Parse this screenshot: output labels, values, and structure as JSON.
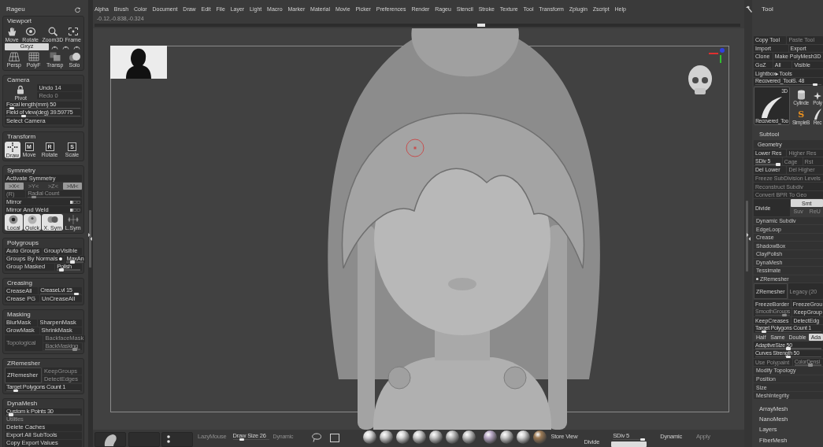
{
  "left_panel": {
    "title": "Rageu",
    "sections": [
      {
        "title": "Viewport",
        "rows": [
          [
            {
              "kind": "tool",
              "text": "Move",
              "selected": false
            },
            {
              "kind": "tool",
              "text": "Rotate",
              "selected": false
            },
            {
              "kind": "tool",
              "text": "Zoom3D",
              "selected": false
            },
            {
              "kind": "tool",
              "text": "Frame",
              "selected": false
            }
          ],
          [
            {
              "kind": "toggle",
              "text": "Gxyz",
              "selected": true,
              "disabled": false
            },
            {
              "kind": "mini",
              "selected": false
            },
            {
              "kind": "mini",
              "selected": false
            },
            {
              "kind": "mini",
              "selected": false
            }
          ],
          [
            {
              "kind": "tool",
              "text": "Persp",
              "selected": false
            },
            {
              "kind": "tool",
              "text": "PolyF",
              "selected": false
            },
            {
              "kind": "tool",
              "text": "Transp",
              "selected": false
            },
            {
              "kind": "tool",
              "text": "Solo",
              "selected": false
            }
          ]
        ]
      },
      {
        "title": "Camera",
        "rows": [
          [
            {
              "kind": "tool",
              "text": "Pivot",
              "selected": false
            },
            {
              "kind": "stack",
              "rows": [
                [
                  {
                    "kind": "button",
                    "text": "Undo 14",
                    "disabled": false
                  }
                ],
                [
                  {
                    "kind": "button",
                    "text": "Redo 0",
                    "disabled": true
                  }
                ]
              ]
            }
          ],
          [
            {
              "kind": "slider",
              "text": "Focal length(mm) 50",
              "level": 0.05,
              "disabled": false
            }
          ],
          [
            {
              "kind": "slider",
              "text": "Field of view(deg) 39.59775",
              "level": 0.22,
              "disabled": false
            }
          ],
          [
            {
              "kind": "button",
              "text": "Select Camera",
              "disabled": false
            }
          ]
        ]
      },
      {
        "title": "Transform",
        "rows": [
          [
            {
              "kind": "tool",
              "text": "Draw",
              "selected": true
            },
            {
              "kind": "tool",
              "text": "Move",
              "letter": "M",
              "selected": false
            },
            {
              "kind": "tool",
              "text": "Rotate",
              "letter": "R",
              "selected": false
            },
            {
              "kind": "tool",
              "text": "Scale",
              "letter": "S",
              "selected": false
            }
          ]
        ]
      },
      {
        "title": "Symmetry",
        "rows": [
          [
            {
              "kind": "button",
              "text": "Activate Symmetry",
              "disabled": false
            }
          ],
          [
            {
              "kind": "toggle",
              "text": ">X<",
              "selected": true,
              "disabled": true
            },
            {
              "kind": "toggle",
              "text": ">Y<",
              "selected": false,
              "disabled": true
            },
            {
              "kind": "toggle",
              "text": ">Z<",
              "selected": false,
              "disabled": true
            },
            {
              "kind": "toggle",
              "text": ">M<",
              "selected": true,
              "disabled": true
            }
          ],
          [
            {
              "kind": "button",
              "text": "(R)",
              "disabled": true
            },
            {
              "kind": "slider",
              "text": "Radial Count",
              "level": 0.08,
              "disabled": true
            }
          ],
          [
            {
              "kind": "option",
              "text": "Mirror",
              "disabled": false
            }
          ],
          [
            {
              "kind": "option",
              "text": "Mirror And Weld",
              "disabled": false
            }
          ],
          [
            {
              "kind": "tool",
              "text": "Local",
              "selected": true
            },
            {
              "kind": "tool",
              "text": "Quick",
              "selected": true
            },
            {
              "kind": "tool",
              "text": "X. Sym",
              "selected": true
            },
            {
              "kind": "tool",
              "text": "L.Sym",
              "selected": false
            }
          ]
        ]
      },
      {
        "title": "Polygroups",
        "rows": [
          [
            {
              "kind": "button",
              "text": "Auto Groups",
              "disabled": false
            },
            {
              "kind": "button",
              "text": "GroupVisible",
              "disabled": false
            }
          ],
          [
            {
              "kind": "switch",
              "text": "Groups By Normals",
              "on": true,
              "disabled": false
            },
            {
              "kind": "slider",
              "text": "MaxAn",
              "level": 0.3,
              "disabled": false
            }
          ],
          [
            {
              "kind": "button",
              "text": "Group Masked",
              "disabled": false
            },
            {
              "kind": "slider",
              "text": "Polish",
              "level": 0.1,
              "disabled": false
            }
          ]
        ]
      },
      {
        "title": "Creasing",
        "rows": [
          [
            {
              "kind": "button",
              "text": "CreaseAll",
              "disabled": false
            },
            {
              "kind": "slider",
              "text": "CreaseLvl 15",
              "level": 0.95,
              "disabled": false
            }
          ],
          [
            {
              "kind": "button",
              "text": "Crease PG",
              "disabled": false
            },
            {
              "kind": "button",
              "text": "UnCreaseAll",
              "disabled": false
            }
          ]
        ]
      },
      {
        "title": "Masking",
        "rows": [
          [
            {
              "kind": "button",
              "text": "BlurMask",
              "disabled": false
            },
            {
              "kind": "button",
              "text": "SharpenMask",
              "disabled": false
            }
          ],
          [
            {
              "kind": "button",
              "text": "GrowMask",
              "disabled": false
            },
            {
              "kind": "button",
              "text": "ShrinkMask",
              "disabled": false
            }
          ],
          [
            {
              "kind": "button",
              "text": "Topological",
              "disabled": true
            },
            {
              "kind": "stack",
              "rows": [
                [
                  {
                    "kind": "button",
                    "text": "BackfaceMask",
                    "disabled": true
                  }
                ],
                [
                  {
                    "kind": "slider",
                    "text": "BackMasking",
                    "level": 0.9,
                    "disabled": true
                  }
                ]
              ]
            }
          ]
        ]
      },
      {
        "title": "ZRemesher",
        "rows": [
          [
            {
              "kind": "action",
              "text": "ZRemesher",
              "disabled": false
            },
            {
              "kind": "stack",
              "rows": [
                [
                  {
                    "kind": "button",
                    "text": "KeepGroups",
                    "disabled": true
                  }
                ],
                [
                  {
                    "kind": "button",
                    "text": "DetectEdges",
                    "disabled": true
                  }
                ]
              ]
            }
          ],
          [
            {
              "kind": "slider",
              "text": "Target Polygons Count 1",
              "level": 0.1,
              "disabled": false
            }
          ]
        ]
      },
      {
        "title": "DynaMesh",
        "rows": [
          [
            {
              "kind": "slider",
              "text": "Custom k Points 30",
              "level": 0.03,
              "disabled": false
            }
          ],
          [
            {
              "kind": "label",
              "text": "Utilities"
            }
          ],
          [
            {
              "kind": "button",
              "text": "Delete Caches",
              "disabled": false
            }
          ],
          [
            {
              "kind": "button",
              "text": "Export All SubTools",
              "disabled": false
            }
          ],
          [
            {
              "kind": "button",
              "text": "Copy Export Values",
              "disabled": false
            }
          ]
        ]
      }
    ]
  },
  "menu": [
    "Alpha",
    "Brush",
    "Color",
    "Document",
    "Draw",
    "Edit",
    "File",
    "Layer",
    "Light",
    "Macro",
    "Marker",
    "Material",
    "Movie",
    "Picker",
    "Preferences",
    "Render",
    "Rageu",
    "Stencil",
    "Stroke",
    "Texture",
    "Tool",
    "Transform",
    "Zplugin",
    "Zscript",
    "Help"
  ],
  "viewport": {
    "coordinates": "-0.12,-0.838,-0.324",
    "timeline": {
      "level": 0.6
    }
  },
  "bottom_bar": {
    "lazy_mouse": {
      "text": "LazyMouse",
      "disabled": true
    },
    "draw_size": {
      "text": "Draw Size 26",
      "level": 0.2,
      "disabled": false
    },
    "dynamic_size": {
      "text": "Dynamic",
      "disabled": true
    },
    "store_view": {
      "text": "Store View",
      "disabled": false
    },
    "divide": {
      "text": "Divide",
      "disabled": false
    },
    "sdiv": {
      "text": "SDiv 5",
      "level": 1,
      "disabled": false
    },
    "dynamic_subdiv": {
      "text": "Dynamic",
      "disabled": false
    },
    "apply": {
      "text": "Apply",
      "disabled": true
    }
  },
  "right_panel": {
    "title": "Tool",
    "rows": [
      [
        {
          "kind": "button",
          "text": "Copy Tool",
          "disabled": false
        },
        {
          "kind": "button",
          "text": "Paste Tool",
          "disabled": true
        }
      ],
      [
        {
          "kind": "button",
          "text": "Import",
          "disabled": false
        },
        {
          "kind": "button",
          "text": "Export",
          "disabled": false
        }
      ],
      [
        {
          "kind": "button",
          "text": "Clone",
          "disabled": false
        },
        {
          "kind": "button",
          "text": "Make PolyMesh3D",
          "disabled": false
        }
      ],
      [
        {
          "kind": "button",
          "text": "GoZ",
          "disabled": false
        },
        {
          "kind": "button",
          "text": "All",
          "disabled": false
        },
        {
          "kind": "button",
          "text": "Visible",
          "disabled": false
        }
      ],
      [
        {
          "kind": "button",
          "text": "Lightbox▸Tools",
          "disabled": false
        }
      ],
      [
        {
          "kind": "slider",
          "text": "Recovered_ToolS. 48",
          "level": 0.93,
          "disabled": false
        }
      ],
      [
        {
          "kind": "tools",
          "items": [
            {
              "label": "Recovered_Too",
              "tag": "3D"
            },
            {
              "label": "Cylinde"
            },
            {
              "label": "Poly"
            },
            {
              "label": "SimpleB",
              "glyph": "S"
            },
            {
              "label": "Rec"
            }
          ]
        }
      ],
      [
        {
          "kind": "palette",
          "text": "Subtool"
        }
      ],
      [
        {
          "kind": "heading",
          "text": "Geometry"
        }
      ],
      [
        {
          "kind": "button",
          "text": "Lower Res",
          "disabled": false
        },
        {
          "kind": "button",
          "text": "Higher Res",
          "disabled": true
        }
      ],
      [
        {
          "kind": "slider",
          "text": "SDiv 5",
          "level": 1,
          "disabled": false
        },
        {
          "kind": "button",
          "text": "Cage",
          "disabled": true
        },
        {
          "kind": "button",
          "text": "Rst",
          "disabled": true
        }
      ],
      [
        {
          "kind": "button",
          "text": "Del Lower",
          "disabled": false
        },
        {
          "kind": "button",
          "text": "Del Higher",
          "disabled": true
        }
      ],
      [
        {
          "kind": "button",
          "text": "Freeze SubDivision Levels",
          "disabled": true
        }
      ],
      [
        {
          "kind": "button",
          "text": "Reconstruct Subdiv",
          "disabled": true
        }
      ],
      [
        {
          "kind": "button",
          "text": "Convert BPR To Geo",
          "disabled": true
        }
      ],
      [
        {
          "kind": "button",
          "text": "Divide",
          "disabled": false
        },
        {
          "kind": "stack",
          "rows": [
            [
              {
                "kind": "toggle",
                "text": "Smt",
                "selected": true,
                "disabled": false
              }
            ],
            [
              {
                "kind": "toggle",
                "text": "Suv",
                "selected": false,
                "disabled": true
              },
              {
                "kind": "toggle",
                "text": "ReU",
                "selected": false,
                "disabled": true
              }
            ]
          ]
        }
      ],
      [
        {
          "kind": "subpalette",
          "text": "Dynamic Subdiv",
          "expanded": false
        }
      ],
      [
        {
          "kind": "subpalette",
          "text": "EdgeLoop",
          "expanded": false
        }
      ],
      [
        {
          "kind": "subpalette",
          "text": "Crease",
          "expanded": false
        }
      ],
      [
        {
          "kind": "subpalette",
          "text": "ShadowBox",
          "expanded": false
        }
      ],
      [
        {
          "kind": "subpalette",
          "text": "ClayPolish",
          "expanded": false
        }
      ],
      [
        {
          "kind": "subpalette",
          "text": "DynaMesh",
          "expanded": false
        }
      ],
      [
        {
          "kind": "subpalette",
          "text": "Tessimate",
          "expanded": false
        }
      ],
      [
        {
          "kind": "subpalette",
          "text": "ZRemesher",
          "expanded": true
        }
      ],
      [
        {
          "kind": "action",
          "text": "ZRemesher",
          "disabled": false
        },
        {
          "kind": "button",
          "text": "Legacy (20",
          "disabled": true
        }
      ],
      [
        {
          "kind": "button",
          "text": "FreezeBorder",
          "disabled": false
        },
        {
          "kind": "button",
          "text": "FreezeGrou",
          "disabled": false
        }
      ],
      [
        {
          "kind": "slider",
          "text": "SmoothGroups",
          "level": 0.9,
          "disabled": true
        },
        {
          "kind": "button",
          "text": "KeepGroup",
          "disabled": false
        }
      ],
      [
        {
          "kind": "button",
          "text": "KeepCreases",
          "disabled": false
        },
        {
          "kind": "button",
          "text": "DetectEdg",
          "disabled": false
        }
      ],
      [
        {
          "kind": "slider",
          "text": "Target Polygons Count 1",
          "level": 0.1,
          "disabled": false
        }
      ],
      [
        {
          "kind": "toggle",
          "text": "Half",
          "selected": false,
          "disabled": false
        },
        {
          "kind": "toggle",
          "text": "Same",
          "selected": false,
          "disabled": false
        },
        {
          "kind": "toggle",
          "text": "Double",
          "selected": false,
          "disabled": false
        },
        {
          "kind": "toggle",
          "text": "Ada",
          "selected": true,
          "disabled": false
        }
      ],
      [
        {
          "kind": "slider",
          "text": "AdaptiveSize 50",
          "level": 0.5,
          "disabled": false
        }
      ],
      [
        {
          "kind": "slider",
          "text": "Curves Strength 50",
          "level": 0.5,
          "disabled": false
        }
      ],
      [
        {
          "kind": "button",
          "text": "Use Polypaint",
          "disabled": true
        },
        {
          "kind": "slider",
          "text": "ColorDensi",
          "level": 0.6,
          "disabled": true
        }
      ],
      [
        {
          "kind": "subpalette",
          "text": "Modify Topology",
          "expanded": false
        }
      ],
      [
        {
          "kind": "subpalette",
          "text": "Position",
          "expanded": false
        }
      ],
      [
        {
          "kind": "subpalette",
          "text": "Size",
          "expanded": false
        }
      ],
      [
        {
          "kind": "subpalette",
          "text": "MeshIntegrity",
          "expanded": false
        }
      ],
      [
        {
          "kind": "palette",
          "text": "ArrayMesh"
        }
      ],
      [
        {
          "kind": "palette",
          "text": "NanoMesh"
        }
      ],
      [
        {
          "kind": "palette",
          "text": "Layers"
        }
      ],
      [
        {
          "kind": "palette",
          "text": "FiberMesh"
        }
      ]
    ]
  }
}
